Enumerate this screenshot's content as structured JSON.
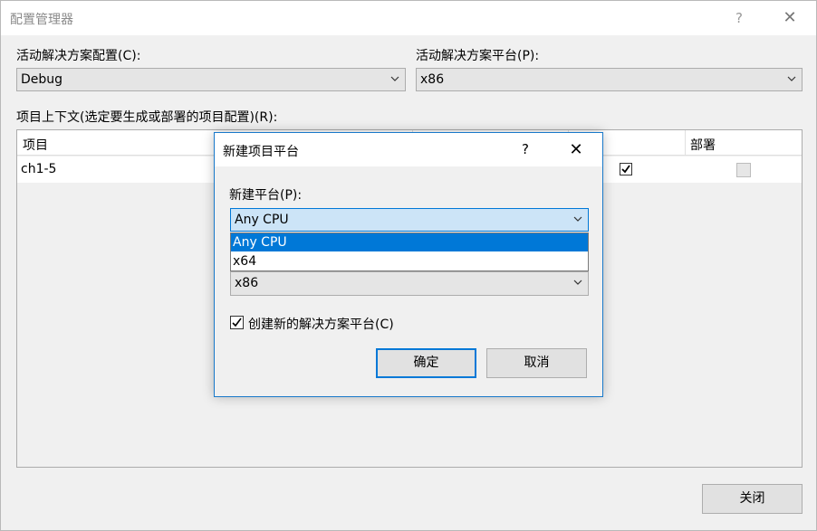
{
  "window": {
    "title": "配置管理器",
    "help": "?",
    "close": "✕"
  },
  "config": {
    "label": "活动解决方案配置(C):",
    "value": "Debug"
  },
  "platform": {
    "label": "活动解决方案平台(P):",
    "value": "x86"
  },
  "context_label": "项目上下文(选定要生成或部署的项目配置)(R):",
  "grid": {
    "columns": {
      "project": "项目",
      "deploy": "部署"
    },
    "rows": [
      {
        "project": "ch1-5"
      }
    ]
  },
  "footer": {
    "close_label": "关闭"
  },
  "dialog": {
    "title": "新建项目平台",
    "help": "?",
    "close": "✕",
    "new_platform_label": "新建平台(P):",
    "new_platform_value": "Any CPU",
    "dropdown_options": [
      "Any CPU",
      "x64"
    ],
    "copy_from_value": "x86",
    "create_solution_platform_label": "创建新的解决方案平台(C)",
    "ok_label": "确定",
    "cancel_label": "取消"
  },
  "colors": {
    "accent": "#0078d7",
    "dialog_border": "#1979ca",
    "selection_bg": "#cce4f7"
  }
}
